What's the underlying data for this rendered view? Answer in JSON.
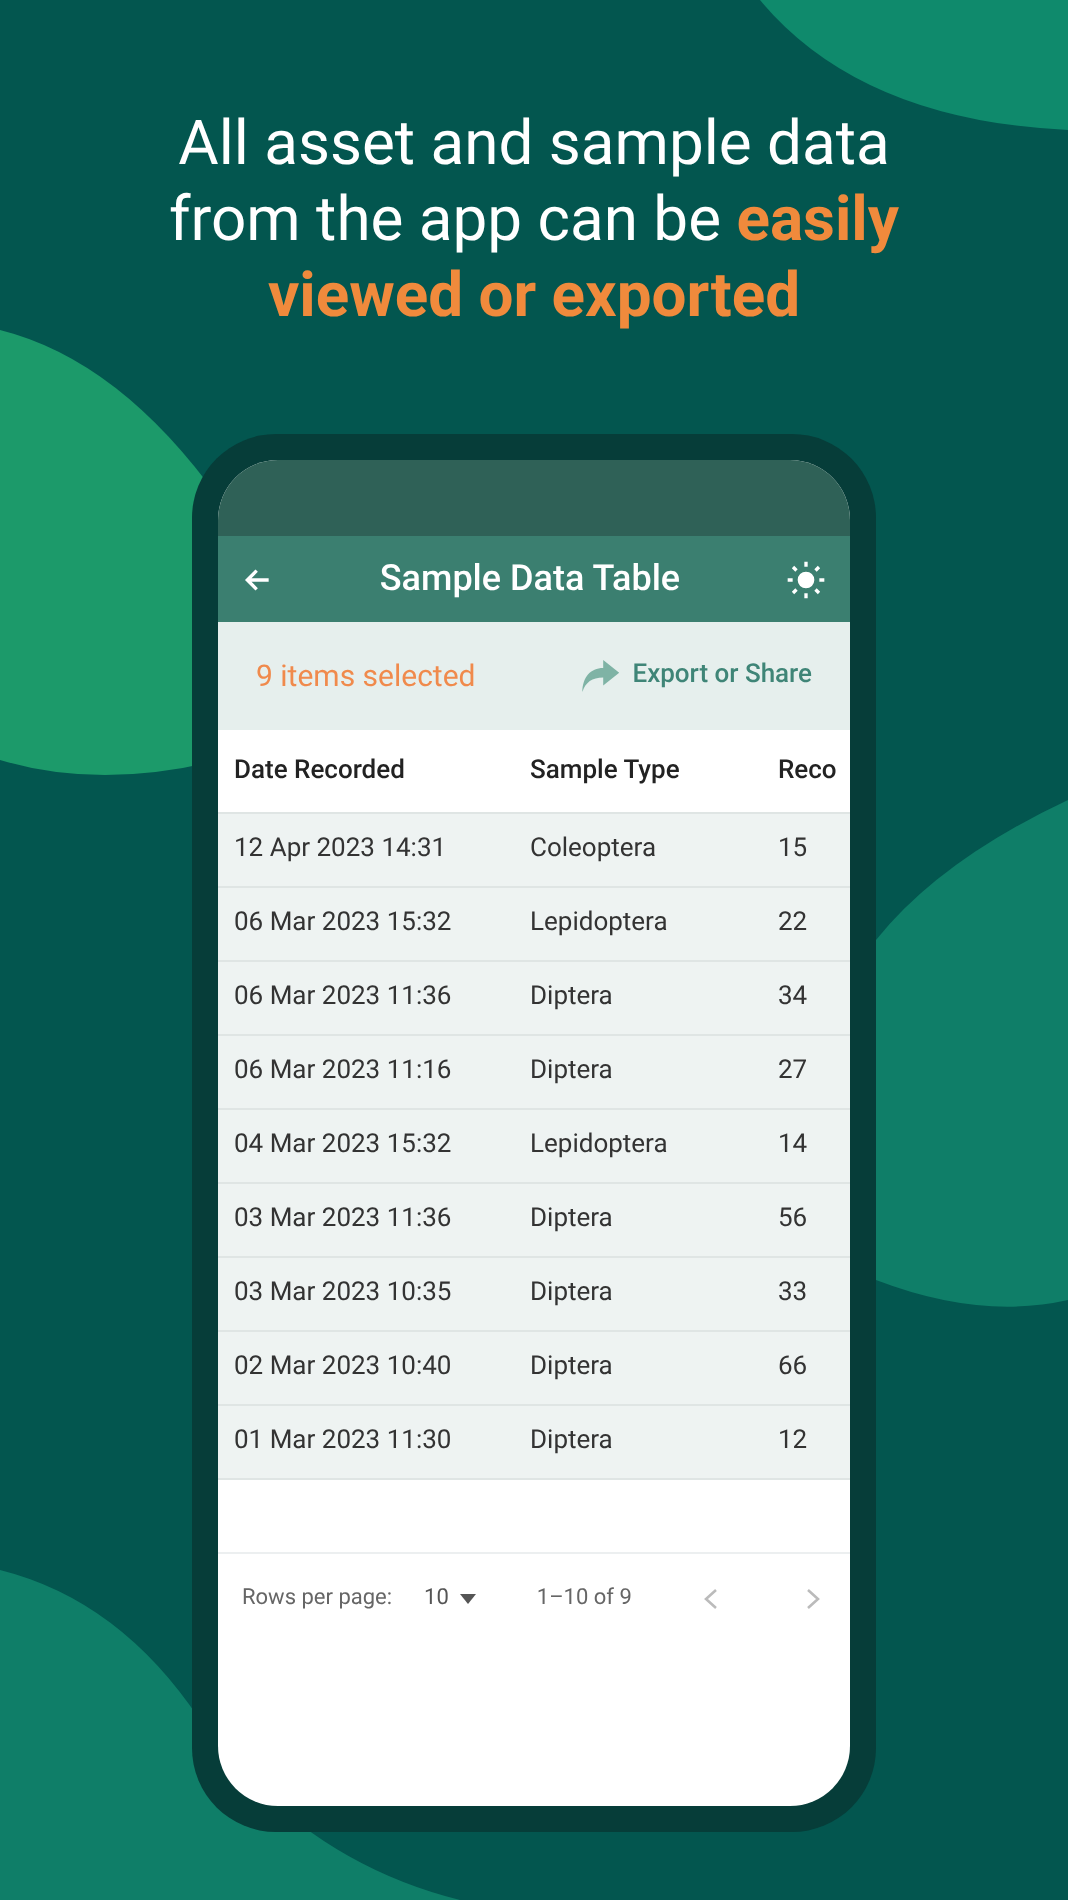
{
  "headline": "All asset and sample data from the app can be **easily viewed or exported**",
  "app_bar": {
    "title": "Sample Data Table"
  },
  "selection_bar": {
    "count": "9 items selected",
    "action": "Export or Share"
  },
  "table": {
    "columns": [
      "Date Recorded",
      "Sample Type",
      "Reco"
    ],
    "rows": [
      {
        "cells": [
          "12 Apr 2023 14:31",
          "Coleoptera",
          "15"
        ],
        "selected": true
      },
      {
        "cells": [
          "06 Mar 2023 15:32",
          "Lepidoptera",
          "22"
        ],
        "selected": true
      },
      {
        "cells": [
          "06 Mar 2023 11:36",
          "Diptera",
          "34"
        ],
        "selected": true
      },
      {
        "cells": [
          "06 Mar 2023 11:16",
          "Diptera",
          "27"
        ],
        "selected": true
      },
      {
        "cells": [
          "04 Mar 2023 15:32",
          "Lepidoptera",
          "14"
        ],
        "selected": true
      },
      {
        "cells": [
          "03 Mar 2023 11:36",
          "Diptera",
          "56"
        ],
        "selected": true
      },
      {
        "cells": [
          "03 Mar 2023 10:35",
          "Diptera",
          "33"
        ],
        "selected": true
      },
      {
        "cells": [
          "02 Mar 2023 10:40",
          "Diptera",
          "66"
        ],
        "selected": true
      },
      {
        "cells": [
          "01 Mar 2023 11:30",
          "Diptera",
          "12"
        ],
        "selected": true
      }
    ]
  },
  "pagination": {
    "rows_per_page_label": "Rows per page:",
    "rows_per_page": "10",
    "range": "1–10 of 9"
  }
}
